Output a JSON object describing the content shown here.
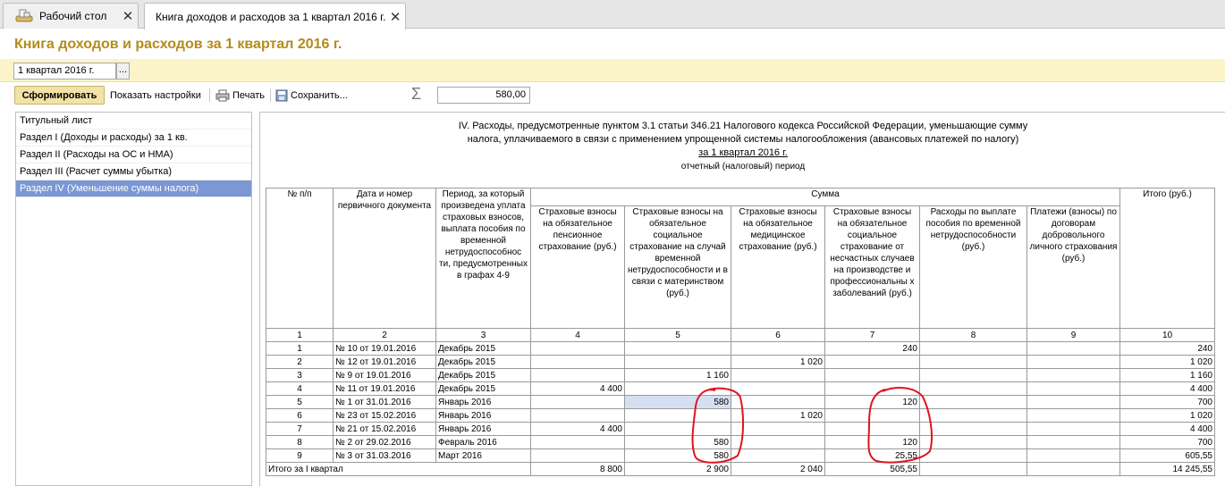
{
  "tabs": [
    {
      "label": "Рабочий стол",
      "icon": "desktop-icon"
    },
    {
      "label": "Книга доходов и расходов за 1 квартал 2016 г.",
      "icon": ""
    }
  ],
  "window": {
    "title": "Книга доходов и расходов за 1 квартал 2016 г."
  },
  "period": {
    "value": "1 квартал 2016 г.",
    "button": "..."
  },
  "toolbar": {
    "generate": "Сформировать",
    "settings": "Показать настройки",
    "print": "Печать",
    "save": "Сохранить...",
    "sum_value": "580,00"
  },
  "nav": [
    {
      "label": "Титульный лист"
    },
    {
      "label": "Раздел I (Доходы и расходы) за 1 кв."
    },
    {
      "label": "Раздел II (Расходы на ОС и НМА)"
    },
    {
      "label": "Раздел III (Расчет суммы убытка)"
    },
    {
      "label": "Раздел IV (Уменьшение суммы налога)"
    }
  ],
  "report": {
    "title_line1": "IV. Расходы, предусмотренные пунктом 3.1 статьи 346.21 Налогового кодекса Российской Федерации, уменьшающие сумму",
    "title_line2": "налога, уплачиваемого в связи с применением упрощенной системы налогообложения (авансовых платежей по налогу)",
    "period_label": "за 1 квартал 2016 г.",
    "period_caption": "отчетный (налоговый) период",
    "headers": {
      "num": "№ п/п",
      "doc": "Дата и номер первичного документа",
      "period": "Период, за который произведена уплата страховых взносов, выплата пособия по временной нетрудоспособнос ти, предусмотренных в графах 4-9",
      "sum": "Сумма",
      "c4": "Страховые взносы на обязательное пенсионное страхование (руб.)",
      "c5": "Страховые взносы на обязательное социальное страхование на случай временной нетрудоспособности и в связи с материнством (руб.)",
      "c6": "Страховые взносы на обязательное медицинское страхование (руб.)",
      "c7": "Страховые взносы на обязательное социальное страхование от несчастных случаев на производстве и профессиональны х заболеваний (руб.)",
      "c8": "Расходы по выплате пособия по временной нетрудоспособности (руб.)",
      "c9": "Платежи (взносы) по договорам добровольного личного страхования (руб.)",
      "c10": "Итого (руб.)"
    },
    "col_numbers": [
      "1",
      "2",
      "3",
      "4",
      "5",
      "6",
      "7",
      "8",
      "9",
      "10"
    ],
    "rows": [
      {
        "n": "1",
        "doc": "№ 10 от 19.01.2016",
        "period": "Декабрь 2015",
        "c4": "",
        "c5": "",
        "c6": "",
        "c7": "240",
        "c8": "",
        "c9": "",
        "c10": "240"
      },
      {
        "n": "2",
        "doc": "№ 12 от 19.01.2016",
        "period": "Декабрь 2015",
        "c4": "",
        "c5": "",
        "c6": "1 020",
        "c7": "",
        "c8": "",
        "c9": "",
        "c10": "1 020"
      },
      {
        "n": "3",
        "doc": "№ 9 от 19.01.2016",
        "period": "Декабрь 2015",
        "c4": "",
        "c5": "1 160",
        "c6": "",
        "c7": "",
        "c8": "",
        "c9": "",
        "c10": "1 160"
      },
      {
        "n": "4",
        "doc": "№ 11 от 19.01.2016",
        "period": "Декабрь 2015",
        "c4": "4 400",
        "c5": "",
        "c6": "",
        "c7": "",
        "c8": "",
        "c9": "",
        "c10": "4 400"
      },
      {
        "n": "5",
        "doc": "№ 1 от 31.01.2016",
        "period": "Январь 2016",
        "c4": "",
        "c5": "580",
        "c6": "",
        "c7": "120",
        "c8": "",
        "c9": "",
        "c10": "700"
      },
      {
        "n": "6",
        "doc": "№ 23 от 15.02.2016",
        "period": "Январь 2016",
        "c4": "",
        "c5": "",
        "c6": "1 020",
        "c7": "",
        "c8": "",
        "c9": "",
        "c10": "1 020"
      },
      {
        "n": "7",
        "doc": "№ 21 от 15.02.2016",
        "period": "Январь 2016",
        "c4": "4 400",
        "c5": "",
        "c6": "",
        "c7": "",
        "c8": "",
        "c9": "",
        "c10": "4 400"
      },
      {
        "n": "8",
        "doc": "№ 2 от 29.02.2016",
        "period": "Февраль 2016",
        "c4": "",
        "c5": "580",
        "c6": "",
        "c7": "120",
        "c8": "",
        "c9": "",
        "c10": "700"
      },
      {
        "n": "9",
        "doc": "№ 3 от 31.03.2016",
        "period": "Март 2016",
        "c4": "",
        "c5": "580",
        "c6": "",
        "c7": "25,55",
        "c8": "",
        "c9": "",
        "c10": "605,55"
      }
    ],
    "total": {
      "label": "Итого за I квартал",
      "c4": "8 800",
      "c5": "2 900",
      "c6": "2 040",
      "c7": "505,55",
      "c8": "",
      "c9": "",
      "c10": "14 245,55"
    }
  },
  "colors": {
    "title": "#b38c1c",
    "period_bar": "#fbf4c9",
    "selected_nav": "#7b97d4",
    "primary_button": "#f2e2a7",
    "annotation": "#e0141e"
  }
}
